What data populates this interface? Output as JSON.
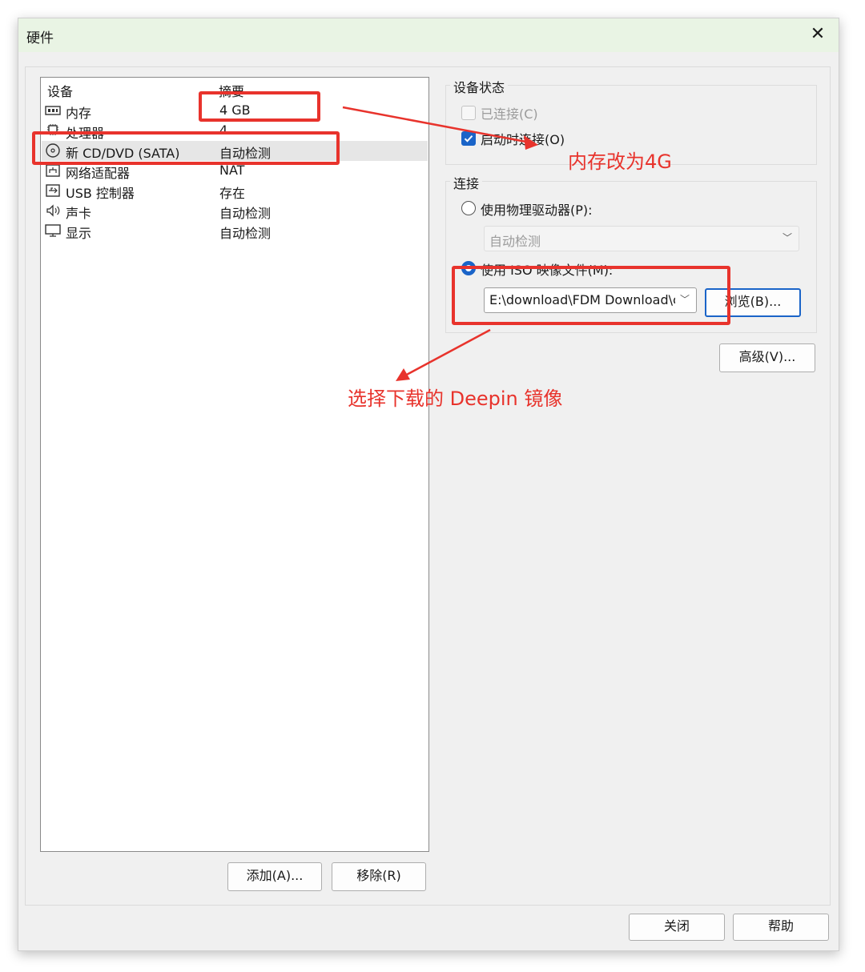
{
  "dialog": {
    "title": "硬件",
    "close_glyph": "✕"
  },
  "device_list": {
    "header_device": "设备",
    "header_summary": "摘要",
    "rows": [
      {
        "name": "内存",
        "summary": "4 GB",
        "icon": "memory-icon"
      },
      {
        "name": "处理器",
        "summary": "4",
        "icon": "processor-icon"
      },
      {
        "name": "新 CD/DVD (SATA)",
        "summary": "自动检测",
        "icon": "cd-dvd-icon",
        "selected": true
      },
      {
        "name": "网络适配器",
        "summary": "NAT",
        "icon": "network-adapter-icon"
      },
      {
        "name": "USB 控制器",
        "summary": "存在",
        "icon": "usb-icon"
      },
      {
        "name": "声卡",
        "summary": "自动检测",
        "icon": "speaker-icon"
      },
      {
        "name": "显示",
        "summary": "自动检测",
        "icon": "display-icon"
      }
    ]
  },
  "list_buttons": {
    "add": "添加(A)...",
    "remove": "移除(R)"
  },
  "device_status": {
    "label": "设备状态",
    "connected": {
      "label": "已连接(C)",
      "checked": false,
      "enabled": false
    },
    "connect_at_power_on": {
      "label": "启动时连接(O)",
      "checked": true
    }
  },
  "connection": {
    "label": "连接",
    "physical_drive": {
      "label": "使用物理驱动器(P):",
      "selected": false
    },
    "physical_drive_select": "自动检测",
    "iso_image": {
      "label": "使用 ISO 映像文件(M):",
      "selected": true
    },
    "iso_path": "E:\\download\\FDM Download\\c",
    "browse": "浏览(B)..."
  },
  "advanced_button": "高级(V)...",
  "footer": {
    "close": "关闭",
    "help": "帮助"
  },
  "annotations": {
    "memory_note": "内存改为4G",
    "iso_note": "选择下载的 Deepin 镜像",
    "color": "#e8332c"
  },
  "colors": {
    "accent": "#1a64c8",
    "titlebar": "#e9f4e4"
  }
}
